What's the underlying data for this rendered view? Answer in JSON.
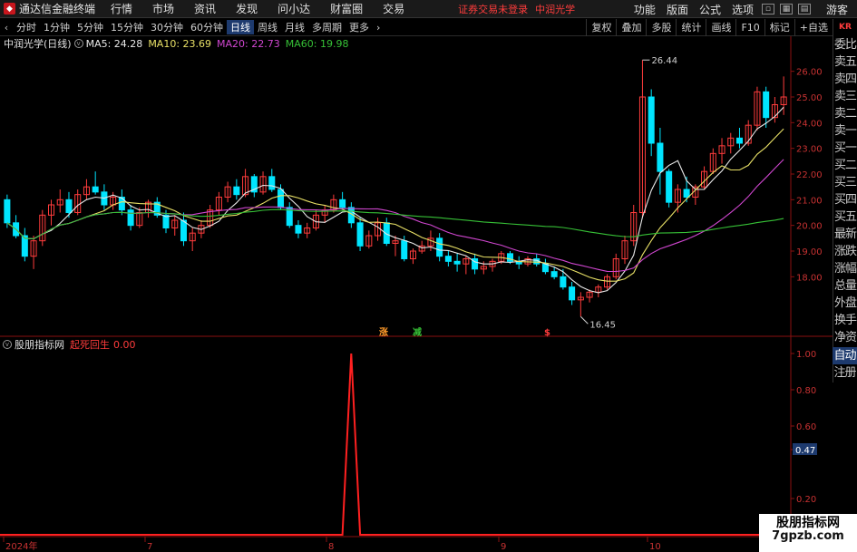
{
  "app": {
    "logo_text": "通达信金融终端",
    "menu": [
      "行情",
      "市场",
      "资讯",
      "发现",
      "问小达",
      "财富圈",
      "交易"
    ],
    "notice": "证券交易未登录",
    "stock_name_top": "中润光学",
    "right_menu": [
      "功能",
      "版面",
      "公式",
      "选项"
    ],
    "guest": "游客"
  },
  "periodbar": {
    "periods": [
      "分时",
      "1分钟",
      "5分钟",
      "15分钟",
      "30分钟",
      "60分钟",
      "日线",
      "周线",
      "月线",
      "多周期",
      "更多"
    ],
    "active": "日线",
    "buttons": [
      "复权",
      "叠加",
      "多股",
      "统计",
      "画线",
      "F10",
      "标记",
      "+自选"
    ]
  },
  "sidepanel": {
    "top_badge": "KR",
    "items": [
      "委比",
      "卖五",
      "卖四",
      "卖三",
      "卖二",
      "卖一",
      "买一",
      "买二",
      "买三",
      "买四",
      "买五",
      "最新",
      "涨跌",
      "涨幅",
      "总量",
      "外盘",
      "换手",
      "净资",
      "收益"
    ],
    "bottom_items": [
      "自动",
      "注册"
    ]
  },
  "main_chart": {
    "title": "中润光学(日线)",
    "ma": [
      {
        "label": "MA5: 24.28",
        "color": "#e8e8e8"
      },
      {
        "label": "MA10: 23.69",
        "color": "#e8e066"
      },
      {
        "label": "MA20: 22.73",
        "color": "#d046d0"
      },
      {
        "label": "MA60: 19.98",
        "color": "#36c036"
      }
    ],
    "price_ticks": [
      "26.00",
      "25.00",
      "24.00",
      "23.00",
      "22.00",
      "21.00",
      "20.00",
      "19.00",
      "18.00"
    ],
    "high_label": "26.44",
    "low_label": "16.45",
    "signals": [
      {
        "text": "涨",
        "color": "#ff9a2a"
      },
      {
        "text": "减",
        "color": "#36c036"
      },
      {
        "text": "$",
        "color": "#ff3c3c"
      }
    ]
  },
  "indicator": {
    "title": "股朋指标网",
    "name": "起死回生",
    "value": "0.00",
    "ticks": [
      "1.00",
      "0.80",
      "0.60",
      "0.47",
      "0.20"
    ],
    "current_value": "0.47"
  },
  "x_axis": {
    "labels": [
      "2024年",
      "7",
      "8",
      "9",
      "10"
    ]
  },
  "watermark": {
    "line1": "股朋指标网",
    "line2": "7gpzb.com"
  },
  "chart_data": {
    "type": "candlestick",
    "title": "中润光学(日线)",
    "ylim": [
      16.0,
      26.8
    ],
    "ma_values": {
      "MA5": 24.28,
      "MA10": 23.69,
      "MA20": 22.73,
      "MA60": 19.98
    },
    "candles": [
      [
        21.0,
        21.2,
        19.9,
        20.1
      ],
      [
        20.1,
        20.4,
        19.5,
        19.6
      ],
      [
        19.6,
        19.9,
        18.6,
        18.8
      ],
      [
        18.8,
        19.6,
        18.3,
        19.4
      ],
      [
        19.4,
        20.6,
        19.2,
        20.4
      ],
      [
        20.4,
        21.0,
        20.0,
        20.8
      ],
      [
        20.8,
        21.4,
        20.5,
        21.0
      ],
      [
        21.0,
        21.3,
        20.3,
        20.5
      ],
      [
        20.5,
        21.4,
        20.4,
        21.2
      ],
      [
        21.2,
        21.8,
        21.0,
        21.5
      ],
      [
        21.5,
        22.1,
        21.2,
        21.3
      ],
      [
        21.3,
        21.6,
        20.6,
        20.8
      ],
      [
        20.8,
        21.3,
        20.6,
        21.1
      ],
      [
        21.1,
        21.4,
        20.4,
        20.6
      ],
      [
        20.6,
        20.8,
        19.8,
        20.0
      ],
      [
        20.0,
        20.7,
        19.9,
        20.5
      ],
      [
        20.5,
        21.0,
        20.3,
        20.9
      ],
      [
        20.9,
        21.1,
        20.3,
        20.4
      ],
      [
        20.4,
        20.6,
        19.7,
        19.9
      ],
      [
        19.9,
        20.4,
        19.6,
        20.2
      ],
      [
        20.2,
        20.5,
        19.2,
        19.4
      ],
      [
        19.4,
        19.9,
        19.0,
        19.7
      ],
      [
        19.7,
        20.2,
        19.5,
        20.0
      ],
      [
        20.0,
        20.8,
        19.9,
        20.6
      ],
      [
        20.6,
        21.3,
        20.4,
        21.1
      ],
      [
        21.1,
        21.7,
        20.9,
        21.5
      ],
      [
        21.5,
        21.8,
        21.0,
        21.2
      ],
      [
        21.2,
        22.2,
        21.1,
        21.9
      ],
      [
        21.9,
        22.0,
        21.1,
        21.3
      ],
      [
        21.3,
        22.1,
        21.2,
        21.9
      ],
      [
        21.9,
        22.2,
        21.3,
        21.4
      ],
      [
        21.4,
        21.6,
        20.6,
        20.7
      ],
      [
        20.7,
        20.9,
        19.9,
        20.0
      ],
      [
        20.0,
        20.2,
        19.5,
        19.7
      ],
      [
        19.7,
        20.1,
        19.5,
        19.9
      ],
      [
        19.9,
        20.6,
        19.8,
        20.4
      ],
      [
        20.4,
        20.8,
        20.1,
        20.6
      ],
      [
        20.6,
        21.2,
        20.5,
        21.0
      ],
      [
        21.0,
        21.3,
        20.6,
        20.7
      ],
      [
        20.7,
        20.9,
        19.9,
        20.1
      ],
      [
        20.1,
        20.3,
        19.0,
        19.2
      ],
      [
        19.2,
        19.8,
        19.1,
        19.6
      ],
      [
        19.6,
        20.3,
        19.4,
        20.1
      ],
      [
        20.1,
        20.3,
        19.2,
        19.3
      ],
      [
        19.3,
        19.6,
        18.8,
        19.4
      ],
      [
        19.4,
        19.6,
        18.6,
        18.7
      ],
      [
        18.7,
        19.1,
        18.5,
        19.0
      ],
      [
        19.0,
        19.4,
        18.9,
        19.2
      ],
      [
        19.2,
        19.8,
        19.0,
        19.5
      ],
      [
        19.5,
        19.7,
        18.6,
        18.8
      ],
      [
        18.8,
        19.0,
        18.4,
        18.6
      ],
      [
        18.6,
        18.9,
        18.2,
        18.5
      ],
      [
        18.5,
        18.8,
        18.1,
        18.7
      ],
      [
        18.7,
        18.9,
        18.1,
        18.3
      ],
      [
        18.3,
        18.6,
        18.1,
        18.4
      ],
      [
        18.4,
        18.7,
        18.2,
        18.6
      ],
      [
        18.6,
        19.0,
        18.5,
        18.9
      ],
      [
        18.9,
        19.0,
        18.5,
        18.6
      ],
      [
        18.6,
        18.8,
        18.3,
        18.5
      ],
      [
        18.5,
        18.8,
        18.4,
        18.7
      ],
      [
        18.7,
        18.9,
        18.4,
        18.5
      ],
      [
        18.5,
        18.7,
        18.1,
        18.2
      ],
      [
        18.2,
        18.4,
        17.9,
        18.0
      ],
      [
        18.0,
        18.3,
        17.5,
        17.6
      ],
      [
        17.6,
        17.8,
        16.9,
        17.1
      ],
      [
        17.1,
        17.4,
        16.45,
        17.2
      ],
      [
        17.2,
        17.5,
        17.0,
        17.4
      ],
      [
        17.4,
        17.7,
        17.2,
        17.6
      ],
      [
        17.6,
        18.1,
        17.5,
        18.0
      ],
      [
        18.0,
        18.9,
        17.9,
        18.7
      ],
      [
        18.7,
        19.6,
        18.5,
        19.4
      ],
      [
        19.4,
        20.8,
        19.2,
        20.5
      ],
      [
        20.5,
        26.44,
        20.3,
        25.0
      ],
      [
        25.0,
        25.3,
        22.7,
        23.2
      ],
      [
        23.2,
        23.8,
        21.2,
        22.1
      ],
      [
        22.1,
        22.2,
        20.7,
        20.9
      ],
      [
        20.9,
        21.6,
        20.5,
        21.4
      ],
      [
        21.4,
        21.9,
        20.9,
        21.1
      ],
      [
        21.1,
        21.6,
        20.8,
        21.5
      ],
      [
        21.5,
        22.3,
        21.4,
        22.1
      ],
      [
        22.1,
        23.0,
        22.0,
        22.8
      ],
      [
        22.8,
        23.4,
        22.4,
        23.1
      ],
      [
        23.1,
        23.6,
        22.8,
        23.4
      ],
      [
        23.4,
        23.8,
        23.0,
        23.2
      ],
      [
        23.2,
        24.1,
        23.1,
        23.9
      ],
      [
        23.9,
        25.4,
        23.7,
        25.2
      ],
      [
        25.2,
        25.4,
        23.8,
        24.2
      ],
      [
        24.2,
        25.0,
        24.0,
        24.7
      ],
      [
        24.7,
        25.8,
        24.3,
        25.0
      ]
    ],
    "indicator_series": {
      "name": "起死回生",
      "spike_index": 39,
      "spike_value": 1.0,
      "baseline": 0.0
    }
  }
}
